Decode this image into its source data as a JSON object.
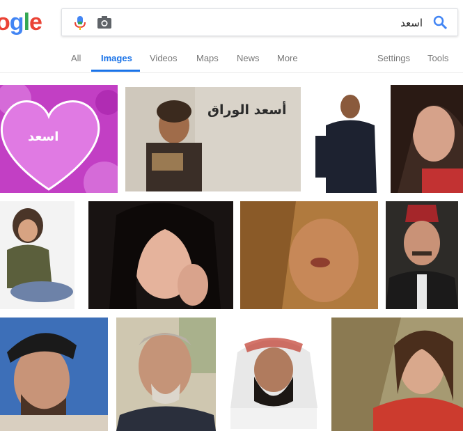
{
  "logo": {
    "letters": [
      "o",
      "g",
      "l",
      "e"
    ],
    "colors": [
      "#ea4335",
      "#4285f4",
      "#34a853",
      "#ea4335"
    ]
  },
  "search": {
    "query": "اسعد"
  },
  "tabs": {
    "all": "All",
    "images": "Images",
    "videos": "Videos",
    "maps": "Maps",
    "news": "News",
    "more": "More",
    "settings": "Settings",
    "tools": "Tools"
  },
  "images": {
    "heart_text": "اسعد",
    "poster_text": "أسعد الوراق"
  },
  "colors": {
    "accent": "#1a73e8",
    "tab_text": "#777777"
  }
}
